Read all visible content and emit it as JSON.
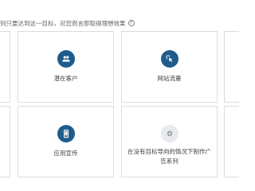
{
  "header": {
    "text": "列只要达到这一目标，对您而言即取得理想效果",
    "help_icon": "help-circle-icon"
  },
  "goals": [
    {
      "label": "潜在客户",
      "icon": "people-icon",
      "icon_style": "blue"
    },
    {
      "label": "网站流量",
      "icon": "cursor-click-icon",
      "icon_style": "blue"
    },
    {
      "label": "应用宣传",
      "icon": "mobile-phone-icon",
      "icon_style": "blue"
    },
    {
      "label": "在没有目标导向的情况下制作广告系列",
      "icon": "gear-icon",
      "icon_style": "gray"
    }
  ],
  "colors": {
    "accent_icon_bg": "#1f5c8c",
    "neutral_icon_bg": "#e8eaed",
    "card_border": "#dadce0"
  }
}
